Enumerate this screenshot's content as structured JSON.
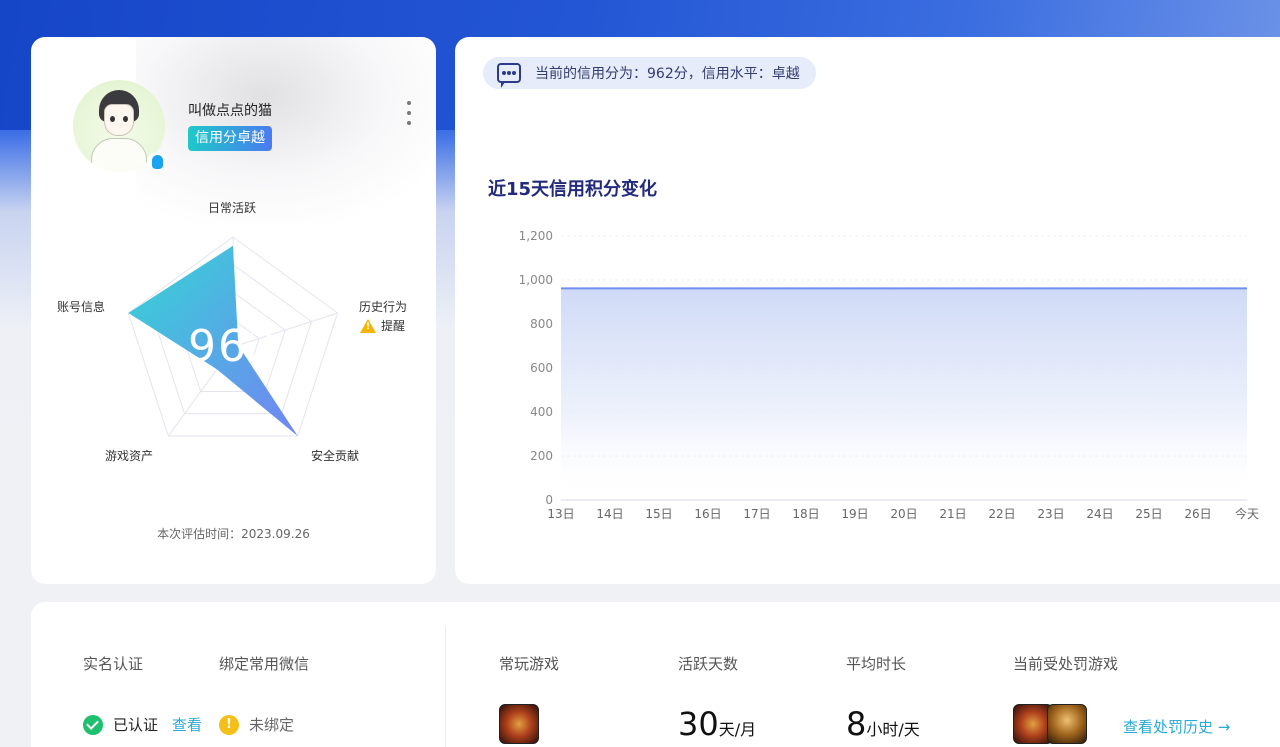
{
  "profile": {
    "username": "叫做点点的猫",
    "level_badge": "信用分卓越",
    "score": "962",
    "radar": {
      "axes": [
        "日常活跃",
        "历史行为",
        "安全贡献",
        "游戏资产",
        "账号信息"
      ],
      "values": [
        0.92,
        0.05,
        1.0,
        0.25,
        1.0
      ]
    },
    "warning_label": "提醒",
    "eval_time": "本次评估时间：2023.09.26"
  },
  "notice": "当前的信用分为：962分，信用水平：卓越",
  "chart_title": "近15天信用积分变化",
  "chart_data": {
    "type": "area",
    "x": [
      "13日",
      "14日",
      "15日",
      "16日",
      "17日",
      "18日",
      "19日",
      "20日",
      "21日",
      "22日",
      "23日",
      "24日",
      "25日",
      "26日",
      "今天"
    ],
    "series": [
      {
        "values": [
          962,
          962,
          962,
          962,
          962,
          962,
          962,
          962,
          962,
          962,
          962,
          962,
          962,
          962,
          962
        ]
      }
    ],
    "yticks": [
      "0",
      "200",
      "400",
      "600",
      "800",
      "1,000",
      "1,200"
    ],
    "ylim": [
      0,
      1200
    ],
    "grid": true,
    "line_color": "#6f8ff0"
  },
  "stats": {
    "real_name": {
      "label": "实名认证",
      "status": "已认证",
      "link": "查看"
    },
    "wechat": {
      "label": "绑定常用微信",
      "status": "未绑定"
    },
    "common_games": {
      "label": "常玩游戏"
    },
    "active_days": {
      "label": "活跃天数",
      "value": "30",
      "unit": "天/月"
    },
    "avg_time": {
      "label": "平均时长",
      "value": "8",
      "unit": "小时/天"
    },
    "punished": {
      "label": "当前受处罚游戏",
      "link": "查看处罚历史 →"
    }
  }
}
